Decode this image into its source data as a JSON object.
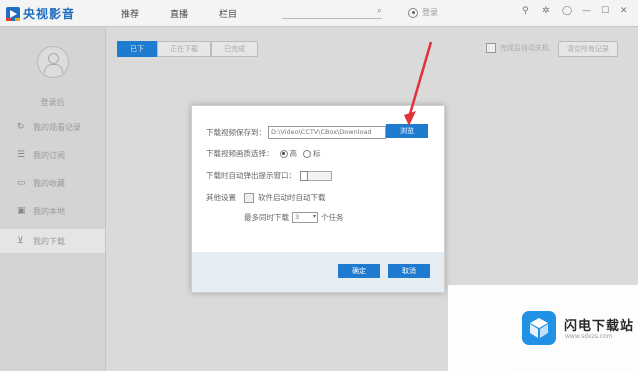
{
  "app": {
    "title": "央视影音",
    "brand_colors": [
      "#1e6fc2",
      "#e83a2c",
      "#f5a623"
    ]
  },
  "topbar": {
    "nav": [
      "推荐",
      "直播",
      "栏目"
    ],
    "search_icon": "search-icon",
    "login_label": "登录",
    "controls": [
      "user-icon",
      "settings-icon",
      "skin-icon",
      "minimize-icon",
      "maximize-icon",
      "close-icon"
    ]
  },
  "sidebar": {
    "user_label": "登录后",
    "items": [
      {
        "icon": "play-history-icon",
        "label": "我的观看记录"
      },
      {
        "icon": "subscribe-icon",
        "label": "我的订阅"
      },
      {
        "icon": "collection-icon",
        "label": "我的收藏"
      },
      {
        "icon": "local-icon",
        "label": "我的本地"
      },
      {
        "icon": "download-icon",
        "label": "我的下载"
      }
    ],
    "active_index": 4
  },
  "main": {
    "tabs": [
      "已下",
      "正在下载",
      "已完成"
    ],
    "active_tab": 0,
    "auto_check_label": "完成后自动关机",
    "clear_label": "清空所有记录"
  },
  "dialog": {
    "path_label": "下载视频保存到：",
    "path_value": "D:\\Video\\CCTV\\CBox\\Download",
    "browse_label": "浏览",
    "quality_label": "下载视频画质选择：",
    "quality_options": [
      "高",
      "标"
    ],
    "quality_selected": 0,
    "popup_label": "下载时自动弹出提示窗口：",
    "other_label": "其他设置",
    "auto_start_label": "软件启动时自动下载",
    "max_tasks_label": "最多同时下载",
    "max_tasks_value": "3",
    "max_tasks_unit": "个任务",
    "ok_label": "确定",
    "cancel_label": "取消"
  },
  "watermark": {
    "title": "闪电下载站",
    "url": "www.sdxzs.com"
  }
}
